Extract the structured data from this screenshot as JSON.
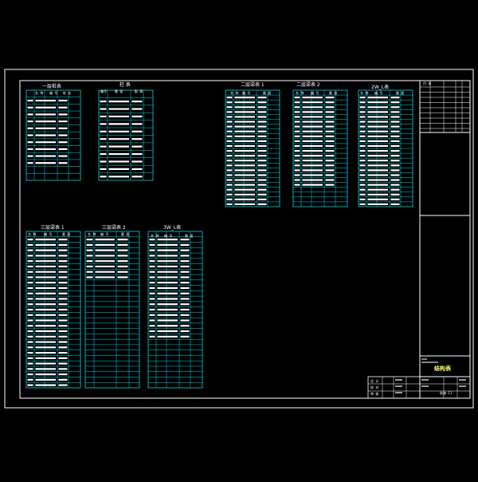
{
  "drawing": {
    "colors": {
      "background": "#000000",
      "frame": "#ffffff",
      "grid": "#00d8e8",
      "text": "#ffffff",
      "stamp_text": "#ffff66"
    },
    "tables": [
      {
        "title": "一层桩表",
        "headers": [
          "名 称",
          "编 号",
          "桩 长"
        ],
        "rows": 13,
        "filled": 11
      },
      {
        "title": "柱 表",
        "headers": [
          "编号",
          "截 面",
          "配 筋"
        ],
        "rows": 12,
        "filled": 12
      },
      {
        "title": "二层梁表 1",
        "headers": [
          "名 称",
          "编 号",
          "截 面"
        ],
        "rows": 24,
        "filled": 24
      },
      {
        "title": "二层梁表 2",
        "headers": [
          "名 称",
          "编 号",
          "截 面"
        ],
        "rows": 24,
        "filled": 20
      },
      {
        "title": "2W_L表",
        "headers": [
          "名 称",
          "编 号",
          "截 面"
        ],
        "rows": 24,
        "filled": 24
      },
      {
        "title": "三层梁表 1",
        "headers": [
          "名 称",
          "编 号",
          "截 面"
        ],
        "rows": 29,
        "filled": 29
      },
      {
        "title": "三层梁表 2",
        "headers": [
          "名 称",
          "编 号",
          "截 面"
        ],
        "rows": 29,
        "filled": 9
      },
      {
        "title": "3W_L表",
        "headers": [
          "名 称",
          "编 号",
          "截 面"
        ],
        "rows": 29,
        "filled": 20
      }
    ],
    "right_panel": {
      "header": "目 录",
      "label": "结构表",
      "drawing_no": "结施-11"
    },
    "title_block": {
      "roles": [
        "设 计",
        "校 对",
        "审 核"
      ]
    }
  }
}
